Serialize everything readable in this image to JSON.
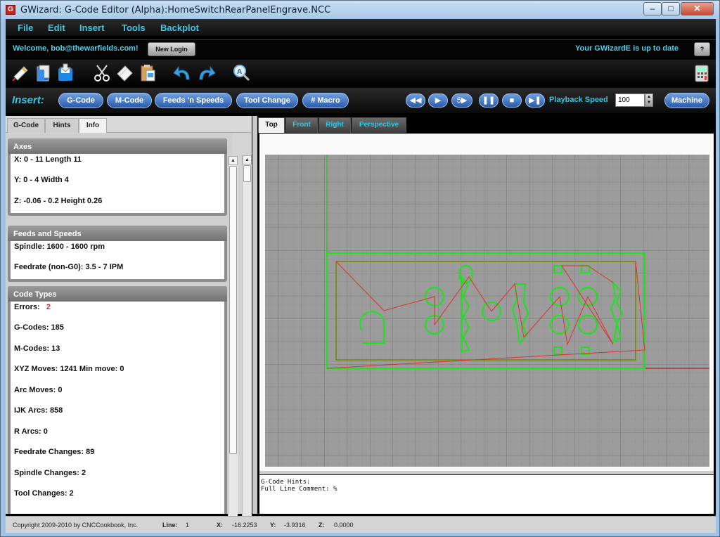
{
  "window": {
    "title": "GWizard: G-Code Editor (Alpha):HomeSwitchRearPanelEngrave.NCC",
    "app_icon": "gwizard-logo-icon",
    "controls": [
      "minimize",
      "maximize",
      "close"
    ]
  },
  "menu": [
    "File",
    "Edit",
    "Insert",
    "Tools",
    "Backplot"
  ],
  "account": {
    "welcome": "Welcome, bob@thewarfields.com!",
    "new_login": "New Login",
    "update_status": "Your GWizardE is up to date",
    "help": "?"
  },
  "toolbar": {
    "icons": [
      "new-file-icon",
      "open-file-icon",
      "save-icon",
      "cut-icon",
      "copy-icon",
      "paste-icon",
      "undo-icon",
      "redo-icon",
      "find-icon",
      "calculator-icon"
    ]
  },
  "insert_bar": {
    "label": "Insert:",
    "buttons": [
      "G-Code",
      "M-Code",
      "Feeds 'n Speeds",
      "Tool Change",
      "# Macro"
    ],
    "playback": {
      "controls": [
        "rewind",
        "play",
        "step",
        "pause",
        "stop",
        "end"
      ],
      "step_label": "5",
      "label": "Playback Speed",
      "speed": "100",
      "machine": "Machine"
    }
  },
  "left_panel": {
    "tabs": [
      "G-Code",
      "Hints",
      "Info"
    ],
    "active_tab": "Info",
    "axes": {
      "title": "Axes",
      "rows": [
        "X:   0     -    11   Length   11",
        "Y:   0     -    4     Width   4",
        "Z:   -0.06   -   0.2   Height   0.26"
      ]
    },
    "feeds": {
      "title": "Feeds and Speeds",
      "rows": [
        "Spindle:   1600    -    1600   rpm",
        "Feedrate (non-G0):   3.5    -    7    IPM"
      ]
    },
    "code_types": {
      "title": "Code Types",
      "errors_label": "Errors:",
      "errors_value": "2",
      "rows": [
        "G-Codes:   185",
        "M-Codes:   13",
        "XYZ Moves:   1241    Min move:    0",
        "Arc Moves:   0",
        "IJK Arcs:   858",
        "R Arcs:   0",
        "Feedrate Changes:   89",
        "Spindle Changes:   2",
        "Tool Changes:   2"
      ]
    }
  },
  "right_panel": {
    "tabs": [
      "Top",
      "Front",
      "Right",
      "Perspective"
    ],
    "active_tab": "Top",
    "hints": {
      "line1": "G-Code Hints:",
      "line2": "Full Line Comment: %"
    }
  },
  "status_bar": {
    "copyright": "Copyright 2009-2010 by CNCCookbook, Inc.",
    "line_label": "Line:",
    "line_value": "1",
    "x_label": "X:",
    "x_value": "-16.2253",
    "y_label": "Y:",
    "y_value": "-3.9316",
    "z_label": "Z:",
    "z_value": "0.0000"
  },
  "colors": {
    "accent_cyan": "#38c6e2",
    "button_blue": "#3b6fbf",
    "toolpath_green": "#19e619",
    "rapid_red": "#e03030",
    "error_red": "#e0202a"
  }
}
